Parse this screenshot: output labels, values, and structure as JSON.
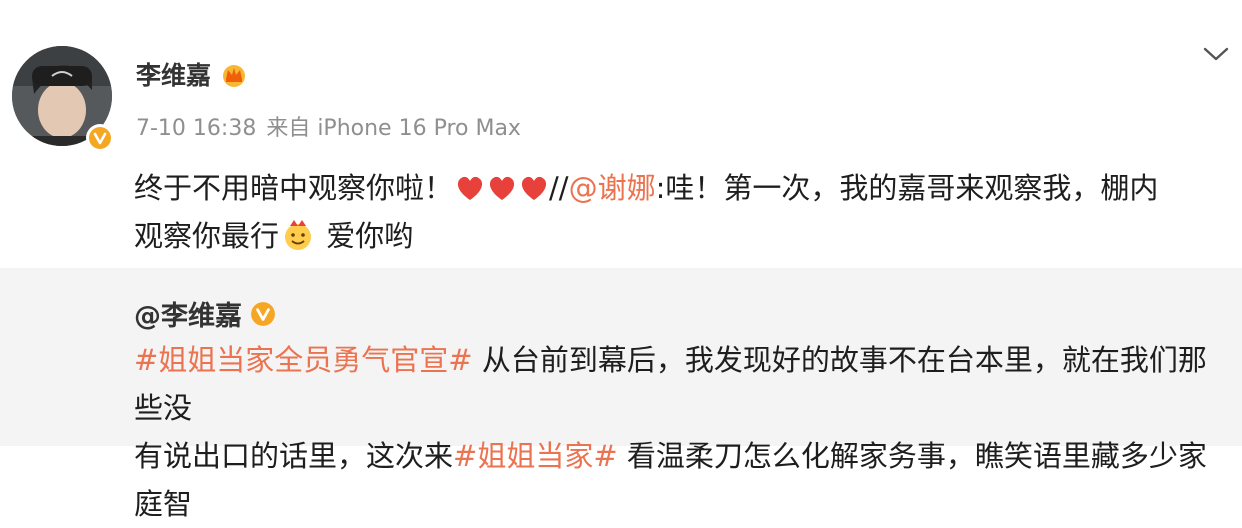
{
  "post": {
    "username": "李维嘉",
    "timestamp": "7-10 16:38",
    "source": "来自 iPhone 16 Pro Max",
    "text_part1": "终于不用暗中观察你啦！",
    "text_part2": "//",
    "mention": "@谢娜",
    "text_part3": ":哇！第一次，我的嘉哥来观察我，棚内",
    "text_part4": "观察你最行",
    "text_part5": " 爱你哟",
    "icons": [
      "crown-badge-icon",
      "verified-badge-icon",
      "chevron-down-icon",
      "heart-icon",
      "face-emoji-icon"
    ]
  },
  "repost": {
    "username": "@李维嘉",
    "tag1": "#姐姐当家全员勇气官宣#",
    "text1": " 从台前到幕后，我发现好的故事不在台本里，就在我们那些没",
    "text2": "有说出口的话里，这次来",
    "tag2": "#姐姐当家#",
    "text3": " 看温柔刀怎么化解家务事，瞧笑语里藏多少家庭智"
  },
  "colors": {
    "accent": "#eb7350",
    "verified": "#f5a623",
    "heart": "#e8403a",
    "repost_bg": "#f4f4f4",
    "meta_text": "#8f8f8f"
  }
}
